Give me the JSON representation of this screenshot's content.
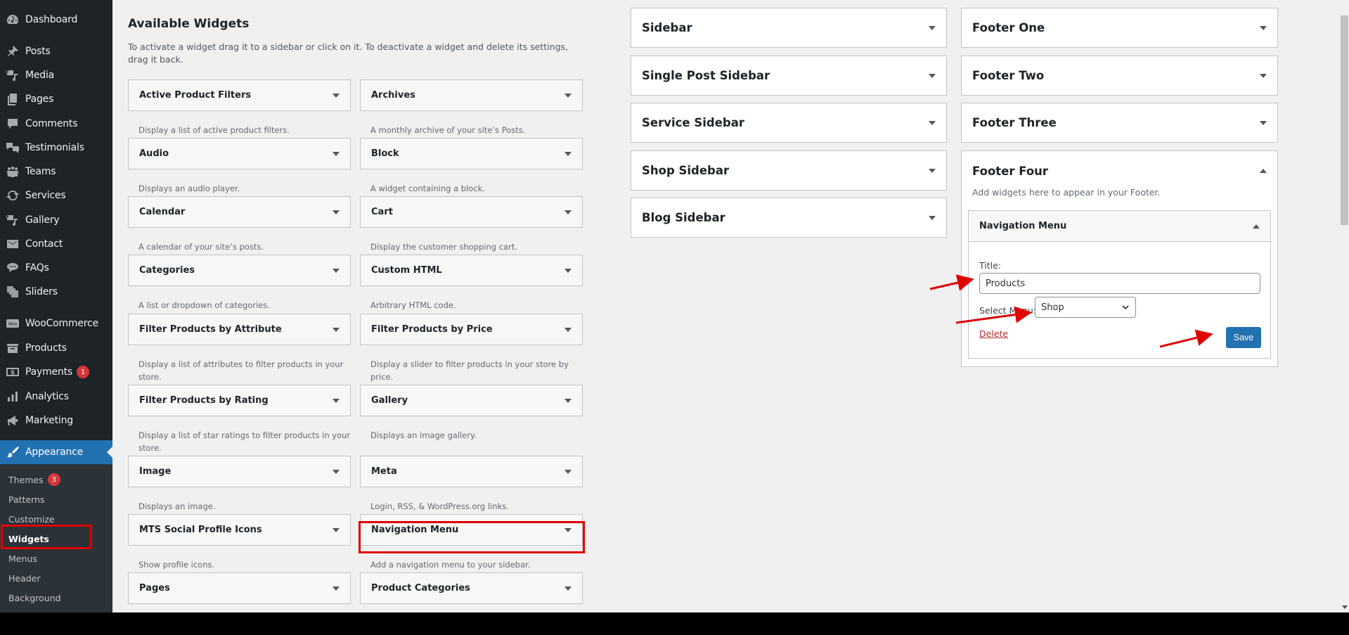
{
  "admin_menu": {
    "items": [
      {
        "label": "Dashboard",
        "icon": "dashboard-icon"
      },
      {
        "label": "Posts",
        "icon": "pin-icon"
      },
      {
        "label": "Media",
        "icon": "media-icon"
      },
      {
        "label": "Pages",
        "icon": "pages-icon"
      },
      {
        "label": "Comments",
        "icon": "comment-icon"
      },
      {
        "label": "Testimonials",
        "icon": "testimonials-icon"
      },
      {
        "label": "Teams",
        "icon": "groups-icon"
      },
      {
        "label": "Services",
        "icon": "update-icon"
      },
      {
        "label": "Gallery",
        "icon": "media-icon"
      },
      {
        "label": "Contact",
        "icon": "email-icon"
      },
      {
        "label": "FAQs",
        "icon": "format-chat-icon"
      },
      {
        "label": "Sliders",
        "icon": "images-icon"
      },
      {
        "label": "WooCommerce",
        "icon": "woo-icon"
      },
      {
        "label": "Products",
        "icon": "archive-icon"
      },
      {
        "label": "Payments",
        "icon": "money-icon",
        "badge": "1"
      },
      {
        "label": "Analytics",
        "icon": "bar-chart-icon"
      },
      {
        "label": "Marketing",
        "icon": "megaphone-icon"
      },
      {
        "label": "Appearance",
        "icon": "paintbrush-icon",
        "current": true
      }
    ],
    "submenu": [
      {
        "label": "Themes",
        "badge": "3"
      },
      {
        "label": "Patterns"
      },
      {
        "label": "Customize"
      },
      {
        "label": "Widgets",
        "current": true
      },
      {
        "label": "Menus"
      },
      {
        "label": "Header"
      },
      {
        "label": "Background"
      }
    ]
  },
  "available_widgets": {
    "title": "Available Widgets",
    "description": "To activate a widget drag it to a sidebar or click on it. To deactivate a widget and delete its settings, drag it back.",
    "widgets": [
      {
        "title": "Active Product Filters",
        "desc": "Display a list of active product filters."
      },
      {
        "title": "Archives",
        "desc": "A monthly archive of your site’s Posts."
      },
      {
        "title": "Audio",
        "desc": "Displays an audio player."
      },
      {
        "title": "Block",
        "desc": "A widget containing a block."
      },
      {
        "title": "Calendar",
        "desc": "A calendar of your site’s posts."
      },
      {
        "title": "Cart",
        "desc": "Display the customer shopping cart."
      },
      {
        "title": "Categories",
        "desc": "A list or dropdown of categories."
      },
      {
        "title": "Custom HTML",
        "desc": "Arbitrary HTML code."
      },
      {
        "title": "Filter Products by Attribute",
        "desc": "Display a list of attributes to filter products in your store."
      },
      {
        "title": "Filter Products by Price",
        "desc": "Display a slider to filter products in your store by price."
      },
      {
        "title": "Filter Products by Rating",
        "desc": "Display a list of star ratings to filter products in your store."
      },
      {
        "title": "Gallery",
        "desc": "Displays an image gallery."
      },
      {
        "title": "Image",
        "desc": "Displays an image."
      },
      {
        "title": "Meta",
        "desc": "Login, RSS, & WordPress.org links."
      },
      {
        "title": "MTS Social Profile Icons",
        "desc": "Show profile icons."
      },
      {
        "title": "Navigation Menu",
        "desc": "Add a navigation menu to your sidebar.",
        "highlighted": true
      },
      {
        "title": "Pages",
        "desc": ""
      },
      {
        "title": "Product Categories",
        "desc": ""
      }
    ]
  },
  "sidebars_left": [
    {
      "title": "Sidebar"
    },
    {
      "title": "Single Post Sidebar"
    },
    {
      "title": "Service Sidebar"
    },
    {
      "title": "Shop Sidebar"
    },
    {
      "title": "Blog Sidebar"
    }
  ],
  "sidebars_right": [
    {
      "title": "Footer One"
    },
    {
      "title": "Footer Two"
    },
    {
      "title": "Footer Three"
    }
  ],
  "footer_four": {
    "title": "Footer Four",
    "description": "Add widgets here to appear in your Footer.",
    "widget": {
      "title": "Navigation Menu",
      "title_label": "Title:",
      "title_value": "Products",
      "menu_label": "Select Menu:",
      "menu_value": "Shop",
      "delete_label": "Delete",
      "save_label": "Save"
    }
  },
  "colors": {
    "admin_bg": "#1d2327",
    "submenu_bg": "#2c3338",
    "accent": "#2271b1",
    "badge": "#d63638",
    "annotation": "#e00000",
    "delete_link": "#b32d2e"
  }
}
